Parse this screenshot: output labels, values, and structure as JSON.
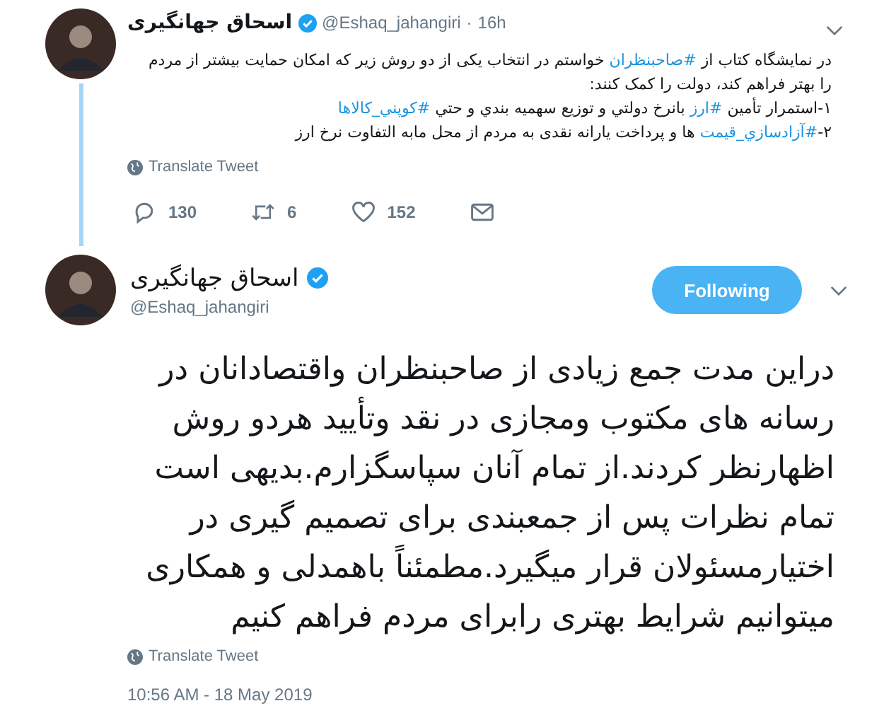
{
  "reply_tweet": {
    "name": "اسحاق جهانگیری",
    "verified": true,
    "handle": "@Eshaq_jahangiri",
    "separator": "·",
    "time": "16h",
    "paragraphs": [
      [
        {
          "kind": "text",
          "text": "در نمایشگاه کتاب از "
        },
        {
          "kind": "hashtag",
          "text": "#صاحبنظران"
        },
        {
          "kind": "text",
          "text": " خواستم در انتخاب یکی از دو روش زیر که امکان حمایت بیشتر از مردم را بهتر فراهم کند، دولت را کمک کنند:"
        }
      ],
      [
        {
          "kind": "text",
          "text": "۱-استمرار تأمین "
        },
        {
          "kind": "hashtag",
          "text": "#ارز"
        },
        {
          "kind": "text",
          "text": " بانرخ دولتي و توزیع سهمیه بندي و حتي "
        },
        {
          "kind": "hashtag",
          "text": "#کوپني_کالاها"
        }
      ],
      [
        {
          "kind": "text",
          "text": "۲-"
        },
        {
          "kind": "hashtag",
          "text": "#آزادسازي_قیمت"
        },
        {
          "kind": "text",
          "text": " ها و پرداخت یارانه نقدی به مردم از محل مابه التفاوت نرخ ارز"
        }
      ]
    ],
    "translate": "Translate Tweet",
    "reply_count": "130",
    "retweet_count": "6",
    "like_count": "152"
  },
  "main_tweet": {
    "name": "اسحاق جهانگیری",
    "verified": true,
    "handle": "@Eshaq_jahangiri",
    "follow_button": "Following",
    "text": "دراین مدت جمع زیادی از صاحبنظران واقتصادانان در\nرسانه های مکتوب ومجازی در نقد وتأیید هردو روش\nاظهارنظر کردند.از تمام آنان سپاسگزارم.بدیهی است\nتمام نظرات پس از جمعبندی برای تصمیم گیری در\nاختیارمسئولان قرار میگیرد.مطمئناً باهمدلی و همکاری\nمیتوانیم شرایط بهتری رابرای مردم فراهم کنیم",
    "translate": "Translate Tweet",
    "timestamp": "10:56 AM - 18 May 2019"
  }
}
